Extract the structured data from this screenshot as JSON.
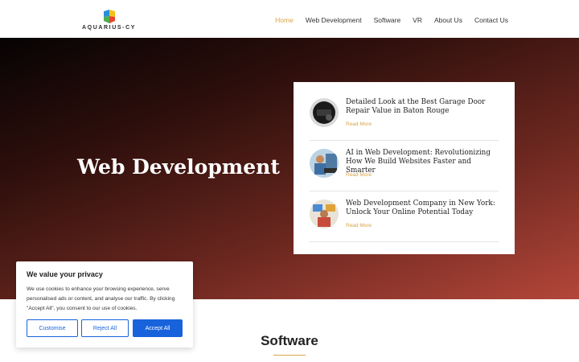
{
  "header": {
    "logo_text": "AQUARIUS-CY",
    "nav": [
      {
        "label": "Home"
      },
      {
        "label": "Web Development"
      },
      {
        "label": "Software"
      },
      {
        "label": "VR"
      },
      {
        "label": "About Us"
      },
      {
        "label": "Contact Us"
      }
    ]
  },
  "hero": {
    "title": "Web Development",
    "posts": [
      {
        "title": "Detailed Look at the Best Garage Door Repair Value in Baton Rouge",
        "read_more": "Read More"
      },
      {
        "title": "AI in Web Development: Revolutionizing How We Build Websites Faster and Smarter",
        "read_more": "Read More"
      },
      {
        "title": "Web Development Company in New York: Unlock Your Online Potential Today",
        "read_more": "Read More"
      }
    ]
  },
  "section": {
    "title": "Software"
  },
  "cookie": {
    "title": "We value your privacy",
    "text": "We use cookies to enhance your browsing experience, serve personalised ads or content, and analyse our traffic. By clicking \"Accept All\", you consent to our use of cookies.",
    "customise": "Customise",
    "reject": "Reject All",
    "accept": "Accept All"
  },
  "colors": {
    "accent": "#d9a44b",
    "button_blue": "#1863dc"
  }
}
